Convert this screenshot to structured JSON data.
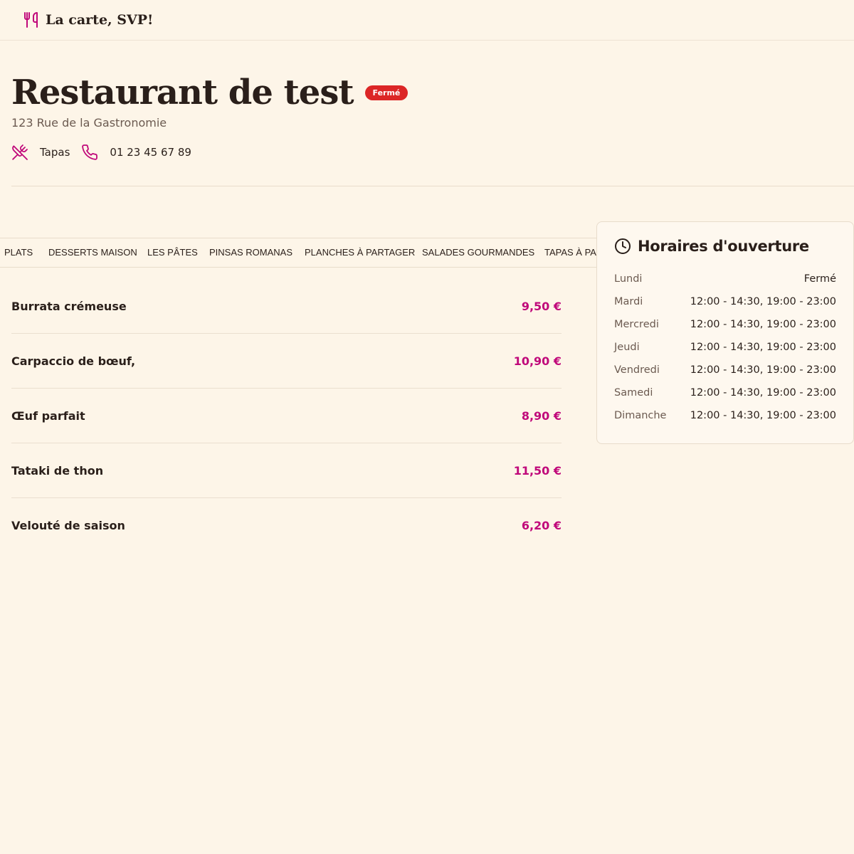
{
  "header": {
    "brand": "La carte, SVP!"
  },
  "restaurant": {
    "name": "Restaurant de test",
    "status": "Fermé",
    "address": "123 Rue de la Gastronomie",
    "cuisine": "Tapas",
    "phone": "01 23 45 67 89"
  },
  "tabs": [
    "PLATS",
    "DESSERTS MAISON",
    "LES PÂTES",
    "PINSAS ROMANAS",
    "PLANCHES À PARTAGER",
    "SALADES GOURMANDES",
    "TAPAS À PARTAGER"
  ],
  "menu_items": [
    {
      "name": "Burrata crémeuse",
      "price": "9,50 €"
    },
    {
      "name": "Carpaccio de bœuf,",
      "price": "10,90 €"
    },
    {
      "name": "Œuf parfait",
      "price": "8,90 €"
    },
    {
      "name": "Tataki de thon",
      "price": "11,50 €"
    },
    {
      "name": "Velouté de saison",
      "price": "6,20 €"
    }
  ],
  "hours": {
    "title": "Horaires d'ouverture",
    "days": [
      {
        "day": "Lundi",
        "time": "Fermé"
      },
      {
        "day": "Mardi",
        "time": "12:00 - 14:30, 19:00 - 23:00"
      },
      {
        "day": "Mercredi",
        "time": "12:00 - 14:30, 19:00 - 23:00"
      },
      {
        "day": "Jeudi",
        "time": "12:00 - 14:30, 19:00 - 23:00"
      },
      {
        "day": "Vendredi",
        "time": "12:00 - 14:30, 19:00 - 23:00"
      },
      {
        "day": "Samedi",
        "time": "12:00 - 14:30, 19:00 - 23:00"
      },
      {
        "day": "Dimanche",
        "time": "12:00 - 14:30, 19:00 - 23:00"
      }
    ]
  },
  "colors": {
    "accent": "#c0087a",
    "badge": "#dc2626",
    "background": "#fdf5e8"
  },
  "icons": {
    "logo": "utensils-icon",
    "cuisine": "utensils-crossed-icon",
    "phone": "phone-icon",
    "hours": "clock-icon"
  }
}
